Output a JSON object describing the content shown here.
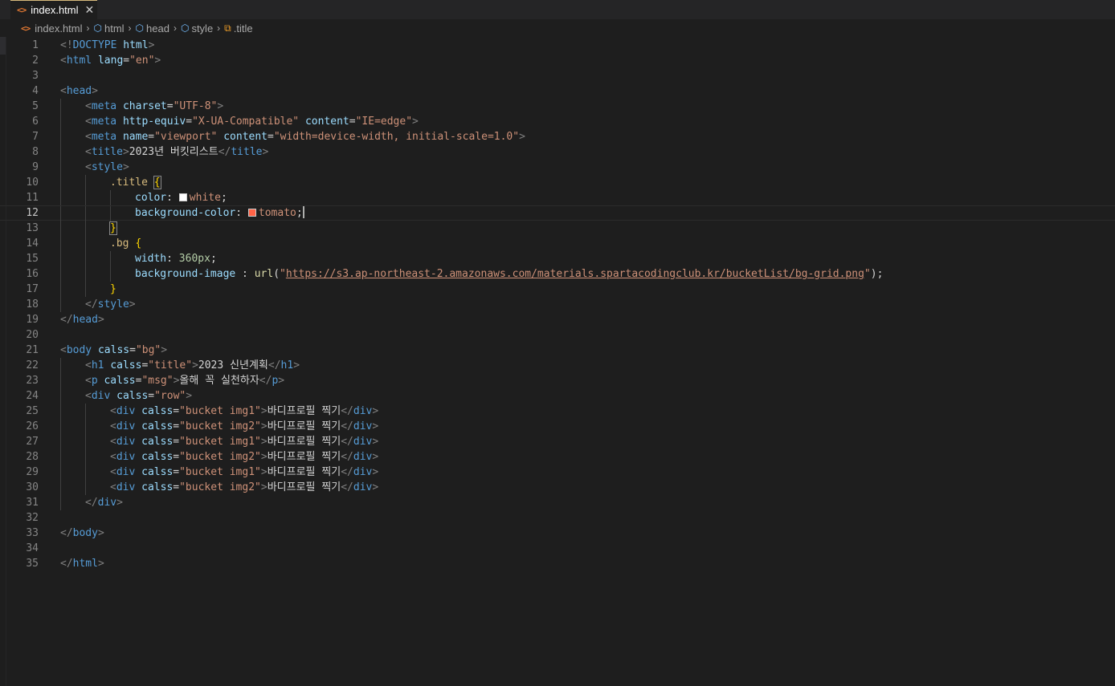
{
  "tab": {
    "icon": "html-file-icon",
    "label": "index.html",
    "close": "✕"
  },
  "breadcrumb": {
    "items": [
      {
        "icon": "html-file-icon",
        "label": "index.html"
      },
      {
        "icon": "element-cube-icon",
        "label": "html"
      },
      {
        "icon": "element-cube-icon",
        "label": "head"
      },
      {
        "icon": "element-cube-icon",
        "label": "style"
      },
      {
        "icon": "css-class-icon",
        "label": ".title"
      }
    ]
  },
  "colors": {
    "accent": "#d7ba7d",
    "white_swatch": "#ffffff",
    "tomato_swatch": "#ff6347"
  },
  "editor": {
    "active_line": 12,
    "lines": [
      {
        "n": "1",
        "indent": 0,
        "tokens": [
          [
            "br",
            "<!"
          ],
          [
            "tag",
            "DOCTYPE"
          ],
          [
            "txt",
            " "
          ],
          [
            "attr",
            "html"
          ],
          [
            "br",
            ">"
          ]
        ]
      },
      {
        "n": "2",
        "indent": 0,
        "tokens": [
          [
            "br",
            "<"
          ],
          [
            "tag",
            "html"
          ],
          [
            "txt",
            " "
          ],
          [
            "attr",
            "lang"
          ],
          [
            "txt",
            "="
          ],
          [
            "str",
            "\"en\""
          ],
          [
            "br",
            ">"
          ]
        ]
      },
      {
        "n": "3",
        "indent": 0,
        "tokens": []
      },
      {
        "n": "4",
        "indent": 0,
        "tokens": [
          [
            "br",
            "<"
          ],
          [
            "tag",
            "head"
          ],
          [
            "br",
            ">"
          ]
        ]
      },
      {
        "n": "5",
        "indent": 1,
        "tokens": [
          [
            "br",
            "<"
          ],
          [
            "tag",
            "meta"
          ],
          [
            "txt",
            " "
          ],
          [
            "attr",
            "charset"
          ],
          [
            "txt",
            "="
          ],
          [
            "str",
            "\"UTF-8\""
          ],
          [
            "br",
            ">"
          ]
        ]
      },
      {
        "n": "6",
        "indent": 1,
        "tokens": [
          [
            "br",
            "<"
          ],
          [
            "tag",
            "meta"
          ],
          [
            "txt",
            " "
          ],
          [
            "attr",
            "http-equiv"
          ],
          [
            "txt",
            "="
          ],
          [
            "str",
            "\"X-UA-Compatible\""
          ],
          [
            "txt",
            " "
          ],
          [
            "attr",
            "content"
          ],
          [
            "txt",
            "="
          ],
          [
            "str",
            "\"IE=edge\""
          ],
          [
            "br",
            ">"
          ]
        ]
      },
      {
        "n": "7",
        "indent": 1,
        "tokens": [
          [
            "br",
            "<"
          ],
          [
            "tag",
            "meta"
          ],
          [
            "txt",
            " "
          ],
          [
            "attr",
            "name"
          ],
          [
            "txt",
            "="
          ],
          [
            "str",
            "\"viewport\""
          ],
          [
            "txt",
            " "
          ],
          [
            "attr",
            "content"
          ],
          [
            "txt",
            "="
          ],
          [
            "str",
            "\"width=device-width, initial-scale=1.0\""
          ],
          [
            "br",
            ">"
          ]
        ]
      },
      {
        "n": "8",
        "indent": 1,
        "tokens": [
          [
            "br",
            "<"
          ],
          [
            "tag",
            "title"
          ],
          [
            "br",
            ">"
          ],
          [
            "txt",
            "2023년 버킷리스트"
          ],
          [
            "br",
            "</"
          ],
          [
            "tag",
            "title"
          ],
          [
            "br",
            ">"
          ]
        ]
      },
      {
        "n": "9",
        "indent": 1,
        "tokens": [
          [
            "br",
            "<"
          ],
          [
            "tag",
            "style"
          ],
          [
            "br",
            ">"
          ]
        ]
      },
      {
        "n": "10",
        "indent": 2,
        "tokens": [
          [
            "sel",
            ".title"
          ],
          [
            "txt",
            " "
          ],
          [
            "bracehl",
            "{"
          ]
        ]
      },
      {
        "n": "11",
        "indent": 3,
        "tokens": [
          [
            "prop",
            "color"
          ],
          [
            "txt",
            ": "
          ],
          [
            "swatch",
            "#ffffff"
          ],
          [
            "val",
            "white"
          ],
          [
            "txt",
            ";"
          ]
        ]
      },
      {
        "n": "12",
        "indent": 3,
        "tokens": [
          [
            "prop",
            "background-color"
          ],
          [
            "txt",
            ": "
          ],
          [
            "swatch",
            "#ff6347"
          ],
          [
            "val",
            "tomato"
          ],
          [
            "txt",
            ";"
          ],
          [
            "cursor",
            ""
          ]
        ]
      },
      {
        "n": "13",
        "indent": 2,
        "tokens": [
          [
            "bracehl",
            "}"
          ]
        ]
      },
      {
        "n": "14",
        "indent": 2,
        "tokens": [
          [
            "sel",
            ".bg"
          ],
          [
            "txt",
            " "
          ],
          [
            "brace",
            "{"
          ]
        ]
      },
      {
        "n": "15",
        "indent": 3,
        "tokens": [
          [
            "prop",
            "width"
          ],
          [
            "txt",
            ": "
          ],
          [
            "num",
            "360px"
          ],
          [
            "txt",
            ";"
          ]
        ]
      },
      {
        "n": "16",
        "indent": 3,
        "tokens": [
          [
            "prop",
            "background-image"
          ],
          [
            "txt",
            " : "
          ],
          [
            "fn",
            "url"
          ],
          [
            "txt",
            "("
          ],
          [
            "str",
            "\""
          ],
          [
            "url",
            "https://s3.ap-northeast-2.amazonaws.com/materials.spartacodingclub.kr/bucketList/bg-grid.png"
          ],
          [
            "str",
            "\""
          ],
          [
            "txt",
            ");"
          ]
        ]
      },
      {
        "n": "17",
        "indent": 2,
        "tokens": [
          [
            "brace",
            "}"
          ]
        ]
      },
      {
        "n": "18",
        "indent": 1,
        "tokens": [
          [
            "br",
            "</"
          ],
          [
            "tag",
            "style"
          ],
          [
            "br",
            ">"
          ]
        ]
      },
      {
        "n": "19",
        "indent": 0,
        "tokens": [
          [
            "br",
            "</"
          ],
          [
            "tag",
            "head"
          ],
          [
            "br",
            ">"
          ]
        ]
      },
      {
        "n": "20",
        "indent": 0,
        "tokens": []
      },
      {
        "n": "21",
        "indent": 0,
        "tokens": [
          [
            "br",
            "<"
          ],
          [
            "tag",
            "body"
          ],
          [
            "txt",
            " "
          ],
          [
            "attr",
            "calss"
          ],
          [
            "txt",
            "="
          ],
          [
            "str",
            "\"bg\""
          ],
          [
            "br",
            ">"
          ]
        ]
      },
      {
        "n": "22",
        "indent": 1,
        "tokens": [
          [
            "br",
            "<"
          ],
          [
            "tag",
            "h1"
          ],
          [
            "txt",
            " "
          ],
          [
            "attr",
            "calss"
          ],
          [
            "txt",
            "="
          ],
          [
            "str",
            "\"title\""
          ],
          [
            "br",
            ">"
          ],
          [
            "txt",
            "2023 신년계획"
          ],
          [
            "br",
            "</"
          ],
          [
            "tag",
            "h1"
          ],
          [
            "br",
            ">"
          ]
        ]
      },
      {
        "n": "23",
        "indent": 1,
        "tokens": [
          [
            "br",
            "<"
          ],
          [
            "tag",
            "p"
          ],
          [
            "txt",
            " "
          ],
          [
            "attr",
            "calss"
          ],
          [
            "txt",
            "="
          ],
          [
            "str",
            "\"msg\""
          ],
          [
            "br",
            ">"
          ],
          [
            "txt",
            "올해 꼭 실천하자"
          ],
          [
            "br",
            "</"
          ],
          [
            "tag",
            "p"
          ],
          [
            "br",
            ">"
          ]
        ]
      },
      {
        "n": "24",
        "indent": 1,
        "tokens": [
          [
            "br",
            "<"
          ],
          [
            "tag",
            "div"
          ],
          [
            "txt",
            " "
          ],
          [
            "attr",
            "calss"
          ],
          [
            "txt",
            "="
          ],
          [
            "str",
            "\"row\""
          ],
          [
            "br",
            ">"
          ]
        ]
      },
      {
        "n": "25",
        "indent": 2,
        "tokens": [
          [
            "br",
            "<"
          ],
          [
            "tag",
            "div"
          ],
          [
            "txt",
            " "
          ],
          [
            "attr",
            "calss"
          ],
          [
            "txt",
            "="
          ],
          [
            "str",
            "\"bucket img1\""
          ],
          [
            "br",
            ">"
          ],
          [
            "txt",
            "바디프로필 찍기"
          ],
          [
            "br",
            "</"
          ],
          [
            "tag",
            "div"
          ],
          [
            "br",
            ">"
          ]
        ]
      },
      {
        "n": "26",
        "indent": 2,
        "tokens": [
          [
            "br",
            "<"
          ],
          [
            "tag",
            "div"
          ],
          [
            "txt",
            " "
          ],
          [
            "attr",
            "calss"
          ],
          [
            "txt",
            "="
          ],
          [
            "str",
            "\"bucket img2\""
          ],
          [
            "br",
            ">"
          ],
          [
            "txt",
            "바디프로필 찍기"
          ],
          [
            "br",
            "</"
          ],
          [
            "tag",
            "div"
          ],
          [
            "br",
            ">"
          ]
        ]
      },
      {
        "n": "27",
        "indent": 2,
        "tokens": [
          [
            "br",
            "<"
          ],
          [
            "tag",
            "div"
          ],
          [
            "txt",
            " "
          ],
          [
            "attr",
            "calss"
          ],
          [
            "txt",
            "="
          ],
          [
            "str",
            "\"bucket img1\""
          ],
          [
            "br",
            ">"
          ],
          [
            "txt",
            "바디프로필 찍기"
          ],
          [
            "br",
            "</"
          ],
          [
            "tag",
            "div"
          ],
          [
            "br",
            ">"
          ]
        ]
      },
      {
        "n": "28",
        "indent": 2,
        "tokens": [
          [
            "br",
            "<"
          ],
          [
            "tag",
            "div"
          ],
          [
            "txt",
            " "
          ],
          [
            "attr",
            "calss"
          ],
          [
            "txt",
            "="
          ],
          [
            "str",
            "\"bucket img2\""
          ],
          [
            "br",
            ">"
          ],
          [
            "txt",
            "바디프로필 찍기"
          ],
          [
            "br",
            "</"
          ],
          [
            "tag",
            "div"
          ],
          [
            "br",
            ">"
          ]
        ]
      },
      {
        "n": "29",
        "indent": 2,
        "tokens": [
          [
            "br",
            "<"
          ],
          [
            "tag",
            "div"
          ],
          [
            "txt",
            " "
          ],
          [
            "attr",
            "calss"
          ],
          [
            "txt",
            "="
          ],
          [
            "str",
            "\"bucket img1\""
          ],
          [
            "br",
            ">"
          ],
          [
            "txt",
            "바디프로필 찍기"
          ],
          [
            "br",
            "</"
          ],
          [
            "tag",
            "div"
          ],
          [
            "br",
            ">"
          ]
        ]
      },
      {
        "n": "30",
        "indent": 2,
        "tokens": [
          [
            "br",
            "<"
          ],
          [
            "tag",
            "div"
          ],
          [
            "txt",
            " "
          ],
          [
            "attr",
            "calss"
          ],
          [
            "txt",
            "="
          ],
          [
            "str",
            "\"bucket img2\""
          ],
          [
            "br",
            ">"
          ],
          [
            "txt",
            "바디프로필 찍기"
          ],
          [
            "br",
            "</"
          ],
          [
            "tag",
            "div"
          ],
          [
            "br",
            ">"
          ]
        ]
      },
      {
        "n": "31",
        "indent": 1,
        "tokens": [
          [
            "br",
            "</"
          ],
          [
            "tag",
            "div"
          ],
          [
            "br",
            ">"
          ]
        ]
      },
      {
        "n": "32",
        "indent": 0,
        "tokens": []
      },
      {
        "n": "33",
        "indent": 0,
        "tokens": [
          [
            "br",
            "</"
          ],
          [
            "tag",
            "body"
          ],
          [
            "br",
            ">"
          ]
        ]
      },
      {
        "n": "34",
        "indent": 0,
        "tokens": []
      },
      {
        "n": "35",
        "indent": 0,
        "tokens": [
          [
            "br",
            "</"
          ],
          [
            "tag",
            "html"
          ],
          [
            "br",
            ">"
          ]
        ]
      }
    ]
  }
}
